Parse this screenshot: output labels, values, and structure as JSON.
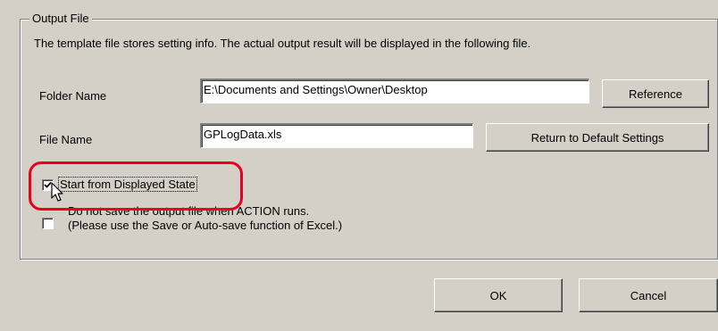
{
  "group": {
    "title": "Output File",
    "description": "The template file stores setting info. The actual output result will be displayed in the following file."
  },
  "folder": {
    "label": "Folder Name",
    "value": "E:\\Documents and Settings\\Owner\\Desktop",
    "button": "Reference"
  },
  "file": {
    "label": "File Name",
    "value": "GPLogData.xls",
    "button": "Return to Default Settings"
  },
  "options": {
    "start_displayed": {
      "label": "Start from Displayed State",
      "checked": true
    },
    "no_save": {
      "label_line1": "Do not save the output file when ACTION runs.",
      "label_line2": "(Please use the Save or Auto-save function of Excel.)",
      "checked": false
    }
  },
  "buttons": {
    "ok": "OK",
    "cancel": "Cancel"
  },
  "colors": {
    "highlight": "#e8001c",
    "dialog_bg": "#d4d0c8"
  }
}
